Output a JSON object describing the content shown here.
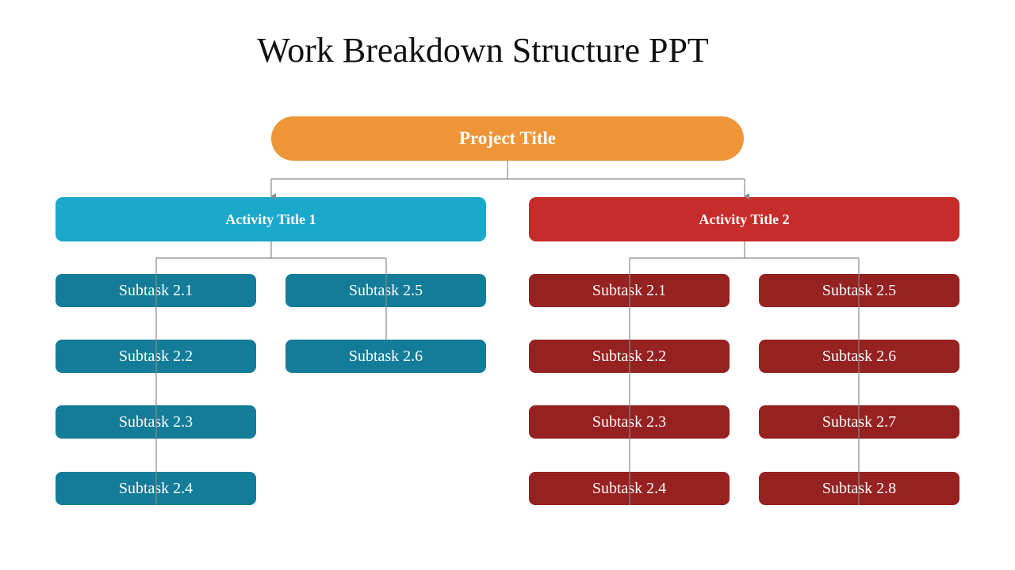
{
  "slide": {
    "title": "Work Breakdown Structure PPT",
    "colors": {
      "project": "#ee9537",
      "activity_1": "#1aa8cb",
      "activity_1_subtask": "#137d99",
      "activity_2": "#c62c29",
      "activity_2_subtask": "#952120",
      "connector": "#8a8a8a"
    }
  },
  "project": {
    "label": "Project Title"
  },
  "activities": [
    {
      "label": "Activity Title 1",
      "columns": [
        [
          "Subtask 2.1",
          "Subtask 2.2",
          "Subtask 2.3",
          "Subtask 2.4"
        ],
        [
          "Subtask 2.5",
          "Subtask 2.6"
        ]
      ]
    },
    {
      "label": "Activity Title 2",
      "columns": [
        [
          "Subtask 2.1",
          "Subtask 2.2",
          "Subtask 2.3",
          "Subtask 2.4"
        ],
        [
          "Subtask 2.5",
          "Subtask 2.6",
          "Subtask 2.7",
          "Subtask 2.8"
        ]
      ]
    }
  ]
}
